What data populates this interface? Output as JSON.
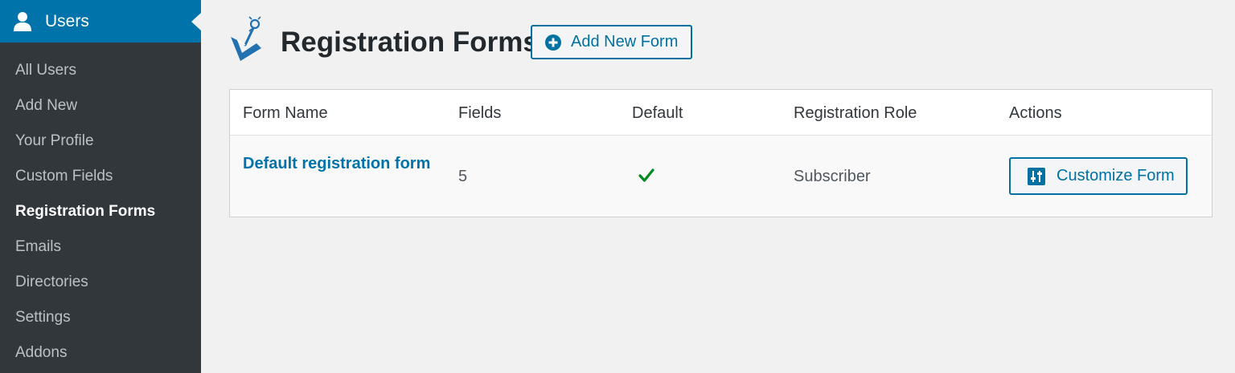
{
  "sidebar": {
    "section_label": "Users",
    "items": [
      {
        "label": "All Users",
        "active": false
      },
      {
        "label": "Add New",
        "active": false
      },
      {
        "label": "Your Profile",
        "active": false
      },
      {
        "label": "Custom Fields",
        "active": false
      },
      {
        "label": "Registration Forms",
        "active": true
      },
      {
        "label": "Emails",
        "active": false
      },
      {
        "label": "Directories",
        "active": false
      },
      {
        "label": "Settings",
        "active": false
      },
      {
        "label": "Addons",
        "active": false
      }
    ]
  },
  "header": {
    "title": "Registration Forms",
    "add_new_label": "Add New Form"
  },
  "table": {
    "columns": [
      "Form Name",
      "Fields",
      "Default",
      "Registration Role",
      "Actions"
    ],
    "rows": [
      {
        "form_name": "Default registration form",
        "fields": "5",
        "default": true,
        "role": "Subscriber",
        "action_label": "Customize Form"
      }
    ]
  },
  "colors": {
    "sidebar_bg": "#32373c",
    "accent": "#0073aa",
    "button_border": "#0071a1",
    "check": "#008a20",
    "page_bg": "#f1f1f1"
  }
}
